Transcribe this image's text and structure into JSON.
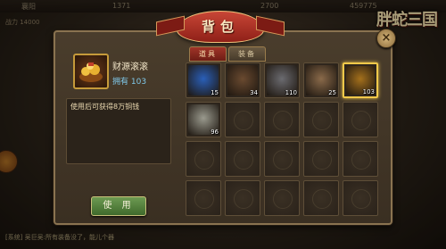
{
  "hud": {
    "location": "襄阳",
    "currency1": "1371",
    "currency2": "2700",
    "currency3": "459775",
    "power": "战力 14000",
    "chat": "[系统] 吴巨吴:所有装备没了，能儿个器",
    "logo_text": "胖蛇三国"
  },
  "panel": {
    "title": "背包",
    "close_label": "×"
  },
  "detail": {
    "item_name": "财源滚滚",
    "owned": "拥有 103",
    "description": "使用后可获得8万铜钱",
    "use_button": "使 用"
  },
  "tabs": [
    {
      "label": "道具",
      "active": true
    },
    {
      "label": "装备",
      "active": false
    }
  ],
  "slots": [
    {
      "icon": "blue-orb-icon",
      "count": "15",
      "color": "#2a5fb8"
    },
    {
      "icon": "soldiers-icon",
      "count": "34",
      "color": "#6a4a30"
    },
    {
      "icon": "catapult-icon",
      "count": "110",
      "color": "#6b6b70"
    },
    {
      "icon": "fortress-icon",
      "count": "25",
      "color": "#8a6a4a"
    },
    {
      "icon": "gold-treasure-icon",
      "count": "103",
      "color": "#a4701c",
      "selected": true
    },
    {
      "icon": "grain-sack-icon",
      "count": "96",
      "color": "#9a9a8e"
    }
  ],
  "colors": {
    "accent_red": "#a03428",
    "selected_gold": "#f1c94a",
    "owned_blue": "#7fc7e8",
    "use_green": "#5a8a42"
  }
}
